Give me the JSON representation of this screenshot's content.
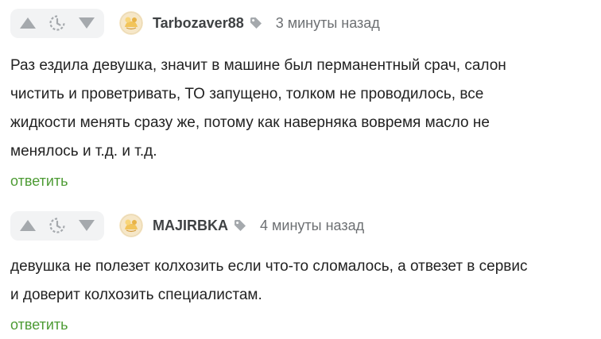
{
  "colors": {
    "vote_bg": "#f2f3f4",
    "vote_icon": "#a5a9ad",
    "reply_link": "#4d9b34",
    "username": "#3f4244",
    "timestamp": "#6d7073"
  },
  "comments": [
    {
      "username": "Tarbozaver88",
      "timestamp": "3 минуты назад",
      "text_lines": [
        "Раз ездила девушка, значит в машине был перманентный срач, салон",
        "чистить и проветривать, ТО запущено, толком не проводилось, все",
        "жидкости менять сразу же, потому как наверняка вовремя масло не",
        "менялось и т.д. и т.д."
      ],
      "reply_label": "ответить",
      "icons": [
        "arrow-up-icon",
        "clock-icon",
        "arrow-down-icon",
        "avatar-image",
        "tag-icon"
      ]
    },
    {
      "username": "MAJIRBKA",
      "timestamp": "4 минуты назад",
      "text_lines": [
        "девушка не полезет колхозить если что-то сломалось, а отвезет в сервис",
        "и доверит колхозить специалистам."
      ],
      "reply_label": "ответить",
      "icons": [
        "arrow-up-icon",
        "clock-icon",
        "arrow-down-icon",
        "avatar-image",
        "tag-icon"
      ]
    }
  ]
}
